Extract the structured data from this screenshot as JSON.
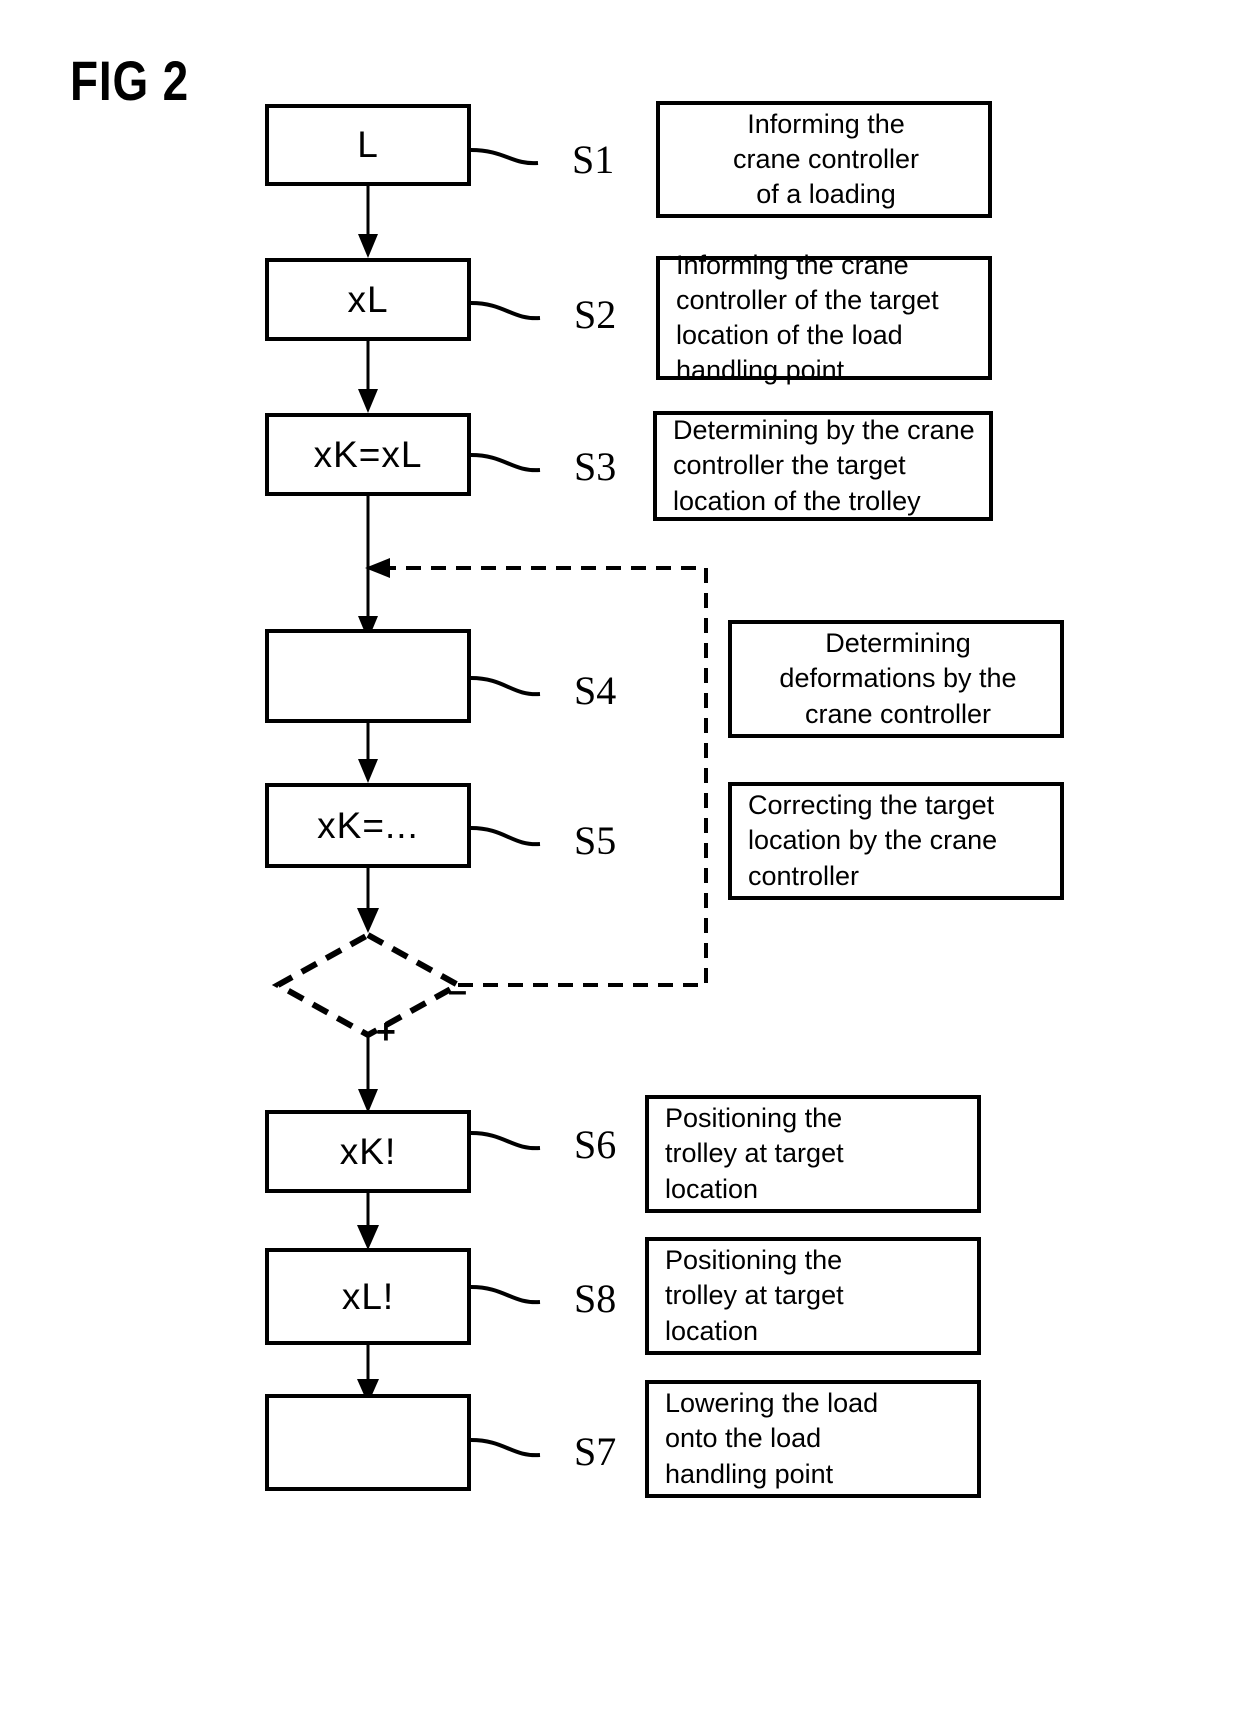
{
  "figure": {
    "label": "FIG 2"
  },
  "process_boxes": [
    {
      "id": "S1",
      "text": "L",
      "step_label": "S1"
    },
    {
      "id": "S2",
      "text": "xL",
      "step_label": "S2"
    },
    {
      "id": "S3",
      "text": "xK=xL",
      "step_label": "S3"
    },
    {
      "id": "S4",
      "text": "",
      "step_label": "S4"
    },
    {
      "id": "S5",
      "text": "xK=...",
      "step_label": "S5"
    },
    {
      "id": "S6",
      "text": "xK!",
      "step_label": "S6"
    },
    {
      "id": "S8",
      "text": "xL!",
      "step_label": "S8"
    },
    {
      "id": "S7",
      "text": "",
      "step_label": "S7"
    }
  ],
  "description_boxes": [
    {
      "for": "S1",
      "align": "center",
      "lines": [
        "Informing the",
        "crane controller",
        "of a loading"
      ]
    },
    {
      "for": "S2",
      "align": "left",
      "lines": [
        "Informing the crane",
        "controller of the target",
        "location of the load",
        "handling point"
      ]
    },
    {
      "for": "S3",
      "align": "left",
      "lines": [
        "Determining by the crane",
        "controller the target",
        "location of the trolley"
      ]
    },
    {
      "for": "S4",
      "align": "center",
      "lines": [
        "Determining",
        "deformations by the",
        "crane controller"
      ]
    },
    {
      "for": "S5",
      "align": "left",
      "lines": [
        "Correcting the target",
        "location by the crane",
        "controller"
      ]
    },
    {
      "for": "S6",
      "align": "left",
      "lines": [
        "Positioning the",
        "trolley at target",
        "location"
      ]
    },
    {
      "for": "S8",
      "align": "left",
      "lines": [
        "Positioning the",
        "trolley at target",
        "location"
      ]
    },
    {
      "for": "S7",
      "align": "left",
      "lines": [
        "Lowering the load",
        "onto the load",
        "handling point"
      ]
    }
  ],
  "decision": {
    "true_label": "+",
    "false_label": "–"
  },
  "colors": {
    "ink": "#000000",
    "paper": "#ffffff"
  }
}
